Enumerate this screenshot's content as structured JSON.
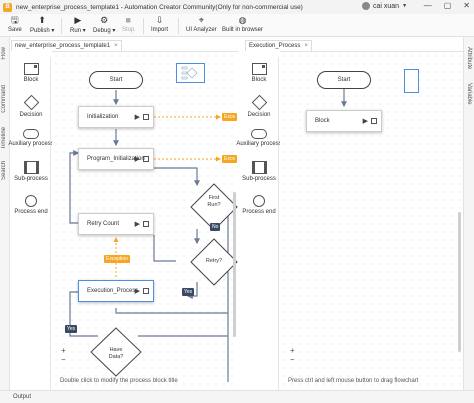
{
  "window": {
    "app_logo": "B",
    "title": "new_enterprise_process_template1 - Automation Creator Community(Only for non-commercial use)",
    "user_name": "cai xuan",
    "controls": [
      "—",
      "▢",
      "✕"
    ]
  },
  "toolbar": {
    "save": "Save",
    "publish": "Publish",
    "run": "Run",
    "debug": "Debug",
    "stop": "Stop",
    "import": "Import",
    "ui_analyzer": "UI Analyzer",
    "built_in_browser": "Built in browser"
  },
  "side_tabs": [
    "Flow",
    "Command",
    "Timeline",
    "Search"
  ],
  "right_tabs": [
    "Attribute",
    "Variable"
  ],
  "palette": {
    "block": "Block",
    "decision": "Decision",
    "auxiliary": "Auxiliary process",
    "subprocess": "Sub-process",
    "end": "Process end"
  },
  "tabs": {
    "main": "new_enterprise_process_template1",
    "sub": "Execution_Process",
    "close": "×"
  },
  "main_flow": {
    "start": "Start",
    "initialization": "Initialization",
    "program_init": "Program_Initialization",
    "first_run_l1": "First",
    "first_run_l2": "Run?",
    "retry_count": "Retry Count",
    "retry": "Retry?",
    "execution_process": "Execution_Process",
    "have_data_l1": "Have",
    "have_data_l2": "Data?",
    "tag_exception_1": "Exce",
    "tag_exception_2": "Exce",
    "tag_exception_3": "Exception",
    "tag_no": "No",
    "tag_yes_1": "Yes",
    "tag_yes_2": "Yes",
    "zoom_in": "+",
    "zoom_out": "−",
    "hint": "Double click to modify the process block title"
  },
  "sub_flow": {
    "start": "Start",
    "block": "Block",
    "zoom_in": "+",
    "zoom_out": "−",
    "hint": "Press ctrl and left mouse button to drag flowchart"
  },
  "output": {
    "label": "Output"
  },
  "colors": {
    "accent": "#4a90e2",
    "exception": "#f5a623",
    "yes_no_tag": "#3b4a63",
    "canvas_bg": "#ffffff"
  }
}
